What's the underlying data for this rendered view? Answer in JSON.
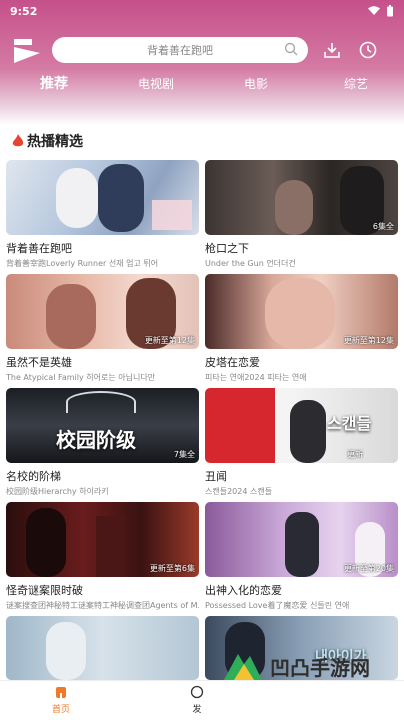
{
  "status_bar": {
    "time": "9:52"
  },
  "search": {
    "placeholder": "背着善在跑吧"
  },
  "tabs": [
    "推荐",
    "电视剧",
    "电影",
    "综艺"
  ],
  "section": {
    "title": "热播精选"
  },
  "cards": [
    {
      "title": "背着善在跑吧",
      "subtitle": "背着善宰跑Loverly Runner 선재 업고 튀어",
      "badge": "",
      "overlay": ""
    },
    {
      "title": "枪口之下",
      "subtitle": "Under the Gun 언더더건",
      "badge": "6集全",
      "overlay": ""
    },
    {
      "title": "虽然不是英雄",
      "subtitle": "The Atypical Family 히어로는 아닙니다만",
      "badge": "更新至第12集",
      "overlay": ""
    },
    {
      "title": "皮塔在恋爱",
      "subtitle": "피타는 연애2024 피타는 연애",
      "badge": "更新至第12集",
      "overlay": ""
    },
    {
      "title": "名校的阶梯",
      "subtitle": "校园阶级Hierarchy 하이라키",
      "badge": "7集全",
      "overlay": "校园阶级"
    },
    {
      "title": "丑闻",
      "subtitle": "스캔들2024 스캔들",
      "badge": "更新",
      "overlay": "스캔들"
    },
    {
      "title": "怪奇谜案限时破",
      "subtitle": "谜案搜查团神秘特工谜案特工神秘调查团Agents of M...",
      "badge": "更新至第6集",
      "overlay": ""
    },
    {
      "title": "出神入化的恋爱",
      "subtitle": "Possessed Love着了魔恋爱 신들린 연애",
      "badge": "更新至第20集",
      "overlay": ""
    },
    {
      "title": "",
      "subtitle": "",
      "badge": "",
      "overlay": ""
    },
    {
      "title": "",
      "subtitle": "",
      "badge": "",
      "overlay": "내아이가"
    }
  ],
  "bottom_nav": {
    "home": "首页",
    "discover": "发"
  },
  "watermark": {
    "text": "凹凸手游网"
  },
  "colors": {
    "brand": "#c6508a",
    "accent": "#f07a2a",
    "flame": "#e8432e"
  }
}
